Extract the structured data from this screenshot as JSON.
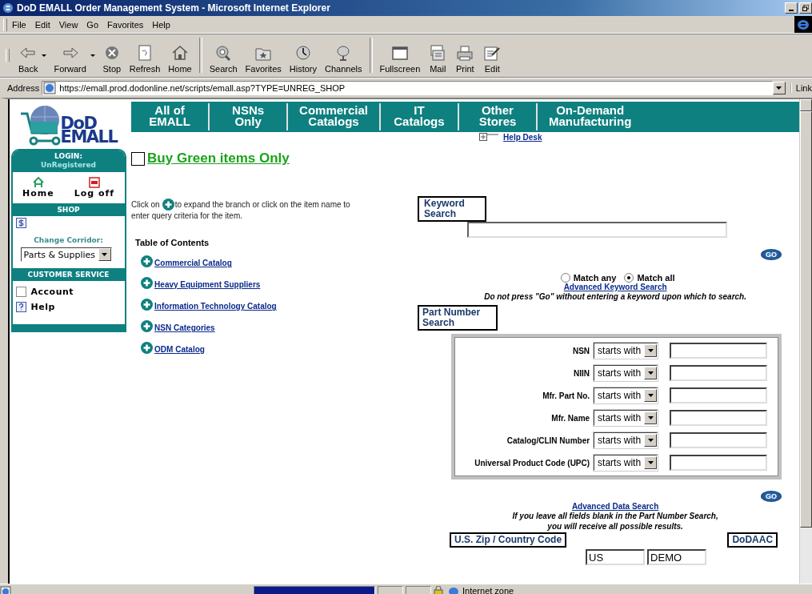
{
  "window": {
    "title": "DoD EMALL Order Management System - Microsoft Internet Explorer"
  },
  "menu": [
    "File",
    "Edit",
    "View",
    "Go",
    "Favorites",
    "Help"
  ],
  "toolbar": [
    {
      "label": "Back",
      "dropdown": true
    },
    {
      "label": "Forward",
      "dropdown": true
    },
    {
      "label": "Stop",
      "dropdown": false
    },
    {
      "label": "Refresh",
      "dropdown": false
    },
    {
      "label": "Home",
      "dropdown": false
    },
    {
      "label": "Search",
      "dropdown": false
    },
    {
      "label": "Favorites",
      "dropdown": false
    },
    {
      "label": "History",
      "dropdown": false
    },
    {
      "label": "Channels",
      "dropdown": false
    },
    {
      "label": "Fullscreen",
      "dropdown": false
    },
    {
      "label": "Mail",
      "dropdown": false
    },
    {
      "label": "Print",
      "dropdown": false
    },
    {
      "label": "Edit",
      "dropdown": false
    }
  ],
  "address": {
    "label": "Address",
    "value": "https://emall.prod.dodonline.net/scripts/emall.asp?TYPE=UNREG_SHOP",
    "links": "Link"
  },
  "logo": {
    "line1": "DoD",
    "line2": "EMALL"
  },
  "nav": [
    "All of\nEMALL",
    "NSNs\nOnly",
    "Commercial\nCatalogs",
    "IT\nCatalogs",
    "Other\nStores",
    "On-Demand\nManufacturing"
  ],
  "help_desk": "Help Desk",
  "sidebar": {
    "login_label": "LOGIN:",
    "login_user": "UnRegistered",
    "home": "Home",
    "logoff": "Log off",
    "shop": "SHOP",
    "change_corridor": "Change Corridor:",
    "corridor": "Parts & Supplies",
    "customer_service": "CUSTOMER SERVICE",
    "service_items": [
      {
        "label": "Account"
      },
      {
        "label": "Help"
      }
    ]
  },
  "green_filter": {
    "label": "Buy Green items Only",
    "checked": false
  },
  "instruction": {
    "before": "Click on",
    "after": "to expand the branch or click on the item name to",
    "continued": "enter query criteria for the item."
  },
  "toc": {
    "title": "Table of Contents",
    "items": [
      "Commercial Catalog",
      "Heavy Equipment Suppliers",
      "Information Technology Catalog",
      "NSN Categories",
      "ODM Catalog"
    ]
  },
  "keyword_search": {
    "label": "Keyword\nSearch",
    "go": "GO",
    "match": [
      {
        "label": "Match any",
        "selected": false
      },
      {
        "label": "Match all",
        "selected": true
      }
    ],
    "advanced": "Advanced Keyword Search",
    "warning": "Do not press \"Go\" without entering a keyword upon which to search."
  },
  "part_search": {
    "label": "Part Number\nSearch",
    "go": "GO",
    "rows": [
      {
        "label": "NSN",
        "operator": "starts with"
      },
      {
        "label": "NIIN",
        "operator": "starts with"
      },
      {
        "label": "Mfr. Part No.",
        "operator": "starts with"
      },
      {
        "label": "Mfr. Name",
        "operator": "starts with"
      },
      {
        "label": "Catalog/CLIN Number",
        "operator": "starts with"
      },
      {
        "label": "Universal Product Code (UPC)",
        "operator": "starts with"
      }
    ],
    "advanced": "Advanced Data Search",
    "note": "If you leave all fields blank in the Part Number Search,\nyou will receive all possible results."
  },
  "location": {
    "zip_label": "U.S. Zip / Country Code",
    "zip": "US",
    "dodaac_label": "DoDAAC",
    "dodaac": "DEMO"
  },
  "status_bar": {
    "zone": "Internet zone"
  }
}
